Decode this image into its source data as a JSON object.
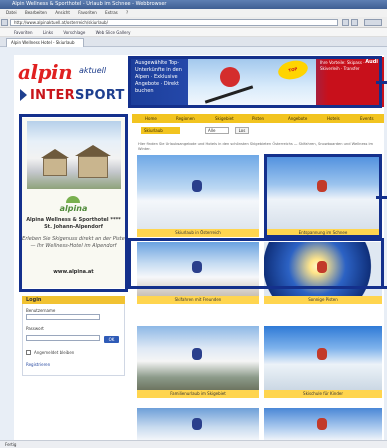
{
  "browser": {
    "title": "Alpin Wellness & Sporthotel - Urlaub im Schnee - Webbrowser",
    "menu": [
      "Datei",
      "Bearbeiten",
      "Ansicht",
      "Favoriten",
      "Extras",
      "?"
    ],
    "address": "http://www.alpinaktuell.at/osterreich/skiurlaub/",
    "bookmarks": [
      "Favoriten",
      "Links",
      "Vorschlage",
      "Web Slice Gallery"
    ],
    "tab": "Alpin Wellness Hotel - Skiurlaub",
    "status": "Fertig"
  },
  "header": {
    "logo_main": "alpin",
    "logo_sub": "aktuell",
    "partner_logo_a": "INTER",
    "partner_logo_b": "SPORT"
  },
  "banner": {
    "left_lines": "Ausgewählte Top-Unterkünfte in den Alpen · Exklusive Angebote · Direkt buchen",
    "badge": "TOP",
    "right_text": "Ihre Vorteile: Skipass · Skiverleih · Transfer",
    "brand": "Audi"
  },
  "left_ad": {
    "logo": "alpina",
    "title": "Alpina Wellness & Sporthotel **** St. Johann-Alpendorf",
    "body": "Erleben Sie Skigenuss direkt an der Piste — Ihr Wellness-Hotel im Alpendorf",
    "url": "www.alpina.at"
  },
  "login": {
    "heading": "Login",
    "user_label": "Benutzername",
    "pass_label": "Passwort",
    "submit": "OK",
    "remember": "Angemeldet bleiben",
    "register": "Registrieren"
  },
  "nav": {
    "items": [
      "Home",
      "Regionen",
      "Skigebiet",
      "Pisten",
      "Angebote",
      "Hotels",
      "Events"
    ]
  },
  "subnav": {
    "active": "Skiurlaub",
    "select": "Alle",
    "go": "Los"
  },
  "intro": "Hier finden Sie Urlaubsangebote und Hotels in den schönsten Skigebieten Österreichs — Skifahren, Snowboarden und Wellness im Winter.",
  "tiles": [
    {
      "caption": "Skiurlaub in Österreich",
      "palette": "skier"
    },
    {
      "caption": "Entspannung im Schnee",
      "palette": "deckchair"
    },
    {
      "caption": "Skifahren mit Freunden",
      "palette": "friends"
    },
    {
      "caption": "Sonnige Pisten",
      "palette": "sun"
    },
    {
      "caption": "Familienurlaub im Skigebiet",
      "palette": "village"
    },
    {
      "caption": "Skischule für Kinder",
      "palette": "group"
    },
    {
      "caption": "Winterurlaub",
      "palette": "mountain"
    },
    {
      "caption": "Skiurlaub",
      "palette": "skier2"
    }
  ]
}
